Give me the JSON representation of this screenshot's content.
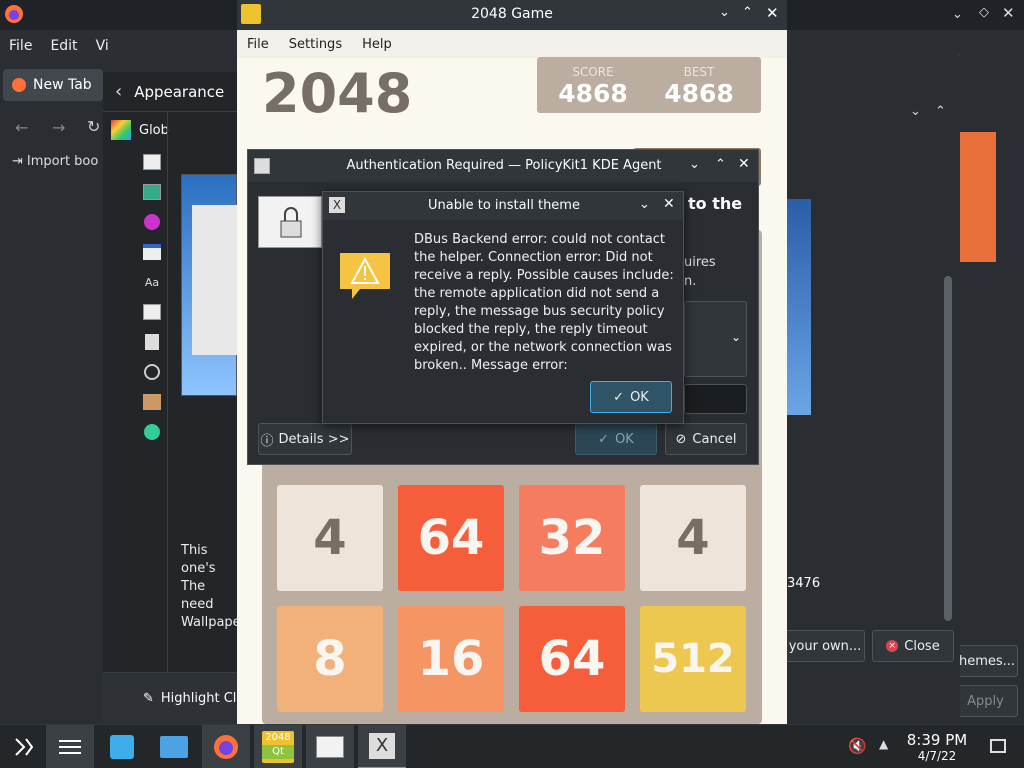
{
  "firefox": {
    "menu": [
      "File",
      "Edit",
      "Vi"
    ],
    "tab": "New Tab",
    "import": "Import boo"
  },
  "settings": {
    "title": "Appearance",
    "global": "Glob",
    "desc": [
      "This one's",
      "The need",
      "Wallpape"
    ],
    "highlight": "Highlight Cl",
    "trailing_number": "3476"
  },
  "kcm": {
    "your_own": "your own...",
    "close": "Close",
    "themes": "hemes...",
    "apply": "Apply"
  },
  "game": {
    "title": "2048 Game",
    "menu": [
      "File",
      "Settings",
      "Help"
    ],
    "logo": "2048",
    "score_label": "SCORE",
    "score": "4868",
    "best_label": "BEST",
    "best": "4868",
    "tiles": [
      {
        "value": "4",
        "color": "#eee4da",
        "text": "#776e65"
      },
      {
        "value": "64",
        "color": "#f65e3b",
        "text": "#f9f6f2"
      },
      {
        "value": "32",
        "color": "#f67c5f",
        "text": "#f9f6f2"
      },
      {
        "value": "4",
        "color": "#eee4da",
        "text": "#776e65"
      },
      {
        "value": "8",
        "color": "#f2b179",
        "text": "#f9f6f2"
      },
      {
        "value": "16",
        "color": "#f59563",
        "text": "#f9f6f2"
      },
      {
        "value": "64",
        "color": "#f65e3b",
        "text": "#f9f6f2"
      },
      {
        "value": "512",
        "color": "#edc850",
        "text": "#f9f6f2"
      }
    ]
  },
  "auth": {
    "title": "Authentication Required — PolicyKit1 KDE Agent",
    "heading_tail": "to the",
    "body_tail": [
      "uires",
      "n."
    ],
    "details": "Details >>",
    "ok": "OK",
    "cancel": "Cancel"
  },
  "error": {
    "title": "Unable to install theme",
    "message": "DBus Backend error: could not contact the helper. Connection error: Did not receive a reply. Possible causes include: the remote application did not send a reply, the message bus security policy blocked the reply, the reply timeout expired, or the network connection was broken.. Message error:",
    "ok": "OK"
  },
  "taskbar": {
    "tile_2048_top": "2048",
    "tile_2048_bottom": "Qt",
    "time": "8:39 PM",
    "date": "4/7/22"
  },
  "colors": {
    "accent": "#3daee9",
    "board": "#bbada0",
    "warning": "#f6c342"
  }
}
